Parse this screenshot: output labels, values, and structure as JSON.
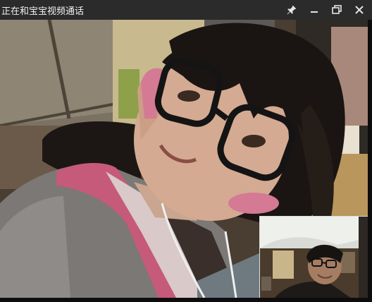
{
  "window": {
    "title": "正在和宝宝视频通话"
  },
  "titlebar_controls": [
    {
      "name": "pin-icon"
    },
    {
      "name": "minimize-icon"
    },
    {
      "name": "restore-icon"
    },
    {
      "name": "close-icon"
    }
  ],
  "colors": {
    "titlebar_bg": "#2b2b2b",
    "title_text": "#f2f2f2"
  }
}
